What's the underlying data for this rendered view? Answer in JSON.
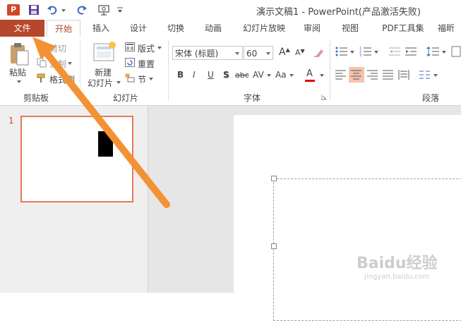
{
  "titlebar": {
    "title": "演示文稿1 - PowerPoint(产品激活失败)",
    "app_icon_letter": "P"
  },
  "tabs": [
    {
      "label": "文件"
    },
    {
      "label": "开始"
    },
    {
      "label": "插入"
    },
    {
      "label": "设计"
    },
    {
      "label": "切换"
    },
    {
      "label": "动画"
    },
    {
      "label": "幻灯片放映"
    },
    {
      "label": "审阅"
    },
    {
      "label": "视图"
    },
    {
      "label": "PDF工具集"
    },
    {
      "label": "福昕PD"
    }
  ],
  "ribbon": {
    "clipboard": {
      "paste": "粘贴",
      "cut": "剪切",
      "copy": "复制",
      "format_painter": "格式刷",
      "group_label": "剪贴板"
    },
    "slides": {
      "new_slide_line1": "新建",
      "new_slide_line2": "幻灯片",
      "layout": "版式",
      "reset": "重置",
      "section": "节",
      "group_label": "幻灯片"
    },
    "font": {
      "font_name": "宋体 (标题)",
      "font_size": "60",
      "group_label": "字体",
      "bold": "B",
      "italic": "I",
      "underline": "U",
      "shadow": "S",
      "strike": "abc",
      "spacing": "AV",
      "case": "Aa",
      "color": "A",
      "grow": "A",
      "shrink": "A"
    },
    "paragraph": {
      "group_label": "段落"
    }
  },
  "thumbnails": [
    {
      "number": "1"
    }
  ],
  "watermark": {
    "brand": "Baidu经验",
    "url": "jingyan.baidu.com"
  },
  "colors": {
    "file_tab": "#b7472a",
    "accent": "#d24726",
    "arrow": "#f39234",
    "thumb_border": "#e8785a",
    "font_color_bar": "#e00000"
  }
}
